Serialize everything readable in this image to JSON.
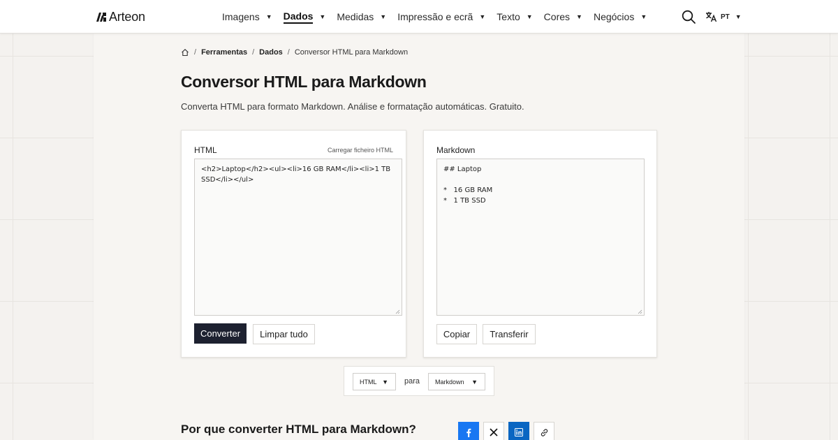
{
  "brand": {
    "name": "Arteon"
  },
  "nav": {
    "items": [
      {
        "label": "Imagens",
        "active": false
      },
      {
        "label": "Dados",
        "active": true
      },
      {
        "label": "Medidas",
        "active": false
      },
      {
        "label": "Impressão e ecrã",
        "active": false
      },
      {
        "label": "Texto",
        "active": false
      },
      {
        "label": "Cores",
        "active": false
      },
      {
        "label": "Negócios",
        "active": false
      }
    ],
    "language": "PT"
  },
  "breadcrumb": {
    "items": [
      "Ferramentas",
      "Dados"
    ],
    "current": "Conversor HTML para Markdown"
  },
  "page": {
    "title": "Conversor HTML para Markdown",
    "subtitle": "Converta HTML para formato Markdown. Análise e formatação automáticas. Gratuito."
  },
  "input_panel": {
    "label": "HTML",
    "upload_link": "Carregar ficheiro HTML",
    "value": "<h2>Laptop</h2><ul><li>16 GB RAM</li><li>1 TB SSD</li></ul>",
    "convert_label": "Converter",
    "clear_label": "Limpar tudo"
  },
  "output_panel": {
    "label": "Markdown",
    "value": "## Laptop\n\n*   16 GB RAM\n*   1 TB SSD",
    "copy_label": "Copiar",
    "download_label": "Transferir"
  },
  "format_bar": {
    "from": "HTML",
    "connector": "para",
    "to": "Markdown"
  },
  "section": {
    "title": "Por que converter HTML para Markdown?"
  },
  "share": {
    "icons": [
      "facebook-icon",
      "x-icon",
      "linkedin-icon",
      "link-icon"
    ]
  },
  "colors": {
    "primary_button": "#1d2130",
    "facebook": "#1877f2",
    "linkedin": "#0a66c2",
    "page_background": "#f4f2ef"
  }
}
